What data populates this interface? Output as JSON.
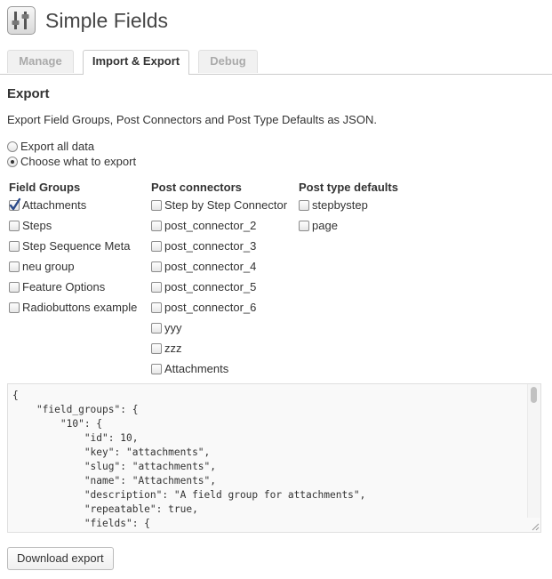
{
  "app": {
    "title": "Simple Fields",
    "logo_icon": "sliders-icon"
  },
  "tabs": [
    {
      "label": "Manage",
      "active": false
    },
    {
      "label": "Import & Export",
      "active": true
    },
    {
      "label": "Debug",
      "active": false
    }
  ],
  "export": {
    "title": "Export",
    "description": "Export Field Groups, Post Connectors and Post Type Defaults as JSON.",
    "options": [
      {
        "label": "Export all data",
        "checked": false
      },
      {
        "label": "Choose what to export",
        "checked": true
      }
    ],
    "columns": {
      "field_groups": {
        "heading": "Field Groups",
        "items": [
          {
            "label": "Attachments",
            "checked": true
          },
          {
            "label": "Steps",
            "checked": false
          },
          {
            "label": "Step Sequence Meta",
            "checked": false
          },
          {
            "label": "neu group",
            "checked": false
          },
          {
            "label": "Feature Options",
            "checked": false
          },
          {
            "label": "Radiobuttons example",
            "checked": false
          }
        ]
      },
      "post_connectors": {
        "heading": "Post connectors",
        "items": [
          {
            "label": "Step by Step Connector",
            "checked": false
          },
          {
            "label": "post_connector_2",
            "checked": false
          },
          {
            "label": "post_connector_3",
            "checked": false
          },
          {
            "label": "post_connector_4",
            "checked": false
          },
          {
            "label": "post_connector_5",
            "checked": false
          },
          {
            "label": "post_connector_6",
            "checked": false
          },
          {
            "label": "yyy",
            "checked": false
          },
          {
            "label": "zzz",
            "checked": false
          },
          {
            "label": "Attachments",
            "checked": false
          }
        ]
      },
      "post_type_defaults": {
        "heading": "Post type defaults",
        "items": [
          {
            "label": "stepbystep",
            "checked": false
          },
          {
            "label": "page",
            "checked": false
          }
        ]
      }
    },
    "json_text": "{\n    \"field_groups\": {\n        \"10\": {\n            \"id\": 10,\n            \"key\": \"attachments\",\n            \"slug\": \"attachments\",\n            \"name\": \"Attachments\",\n            \"description\": \"A field group for attachments\",\n            \"repeatable\": true,\n            \"fields\": {\n                \"0\": {",
    "download_label": "Download export"
  }
}
